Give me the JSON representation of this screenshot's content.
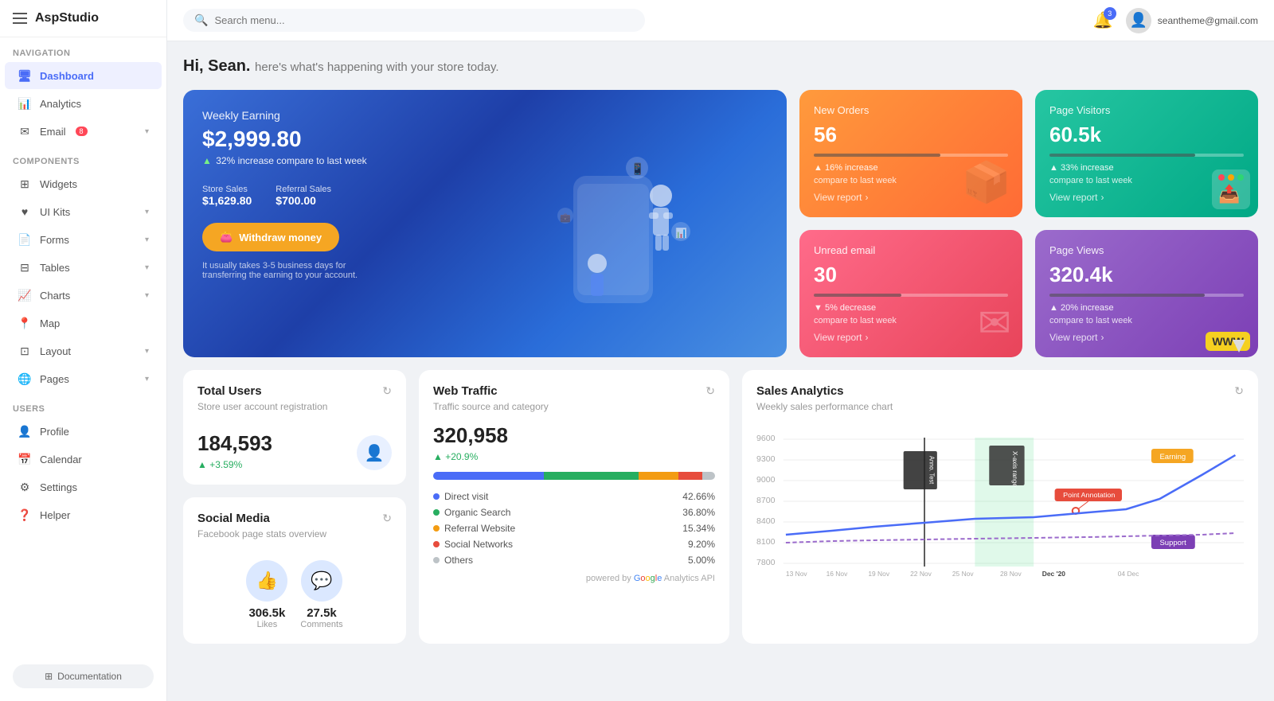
{
  "app": {
    "logo": "AspStudio",
    "search_placeholder": "Search menu..."
  },
  "topbar": {
    "notif_count": "3",
    "user_email": "seantheme@gmail.com"
  },
  "sidebar": {
    "sections": [
      {
        "label": "Navigation",
        "items": [
          {
            "id": "dashboard",
            "label": "Dashboard",
            "icon": "🖥",
            "active": true
          },
          {
            "id": "analytics",
            "label": "Analytics",
            "icon": "📊",
            "active": false
          },
          {
            "id": "email",
            "label": "Email",
            "icon": "✉",
            "active": false,
            "badge": "8",
            "arrow": true
          }
        ]
      },
      {
        "label": "Components",
        "items": [
          {
            "id": "widgets",
            "label": "Widgets",
            "icon": "⊞",
            "active": false
          },
          {
            "id": "ui-kits",
            "label": "UI Kits",
            "icon": "♥",
            "active": false,
            "arrow": true
          },
          {
            "id": "forms",
            "label": "Forms",
            "icon": "📄",
            "active": false,
            "arrow": true
          },
          {
            "id": "tables",
            "label": "Tables",
            "icon": "⊟",
            "active": false,
            "arrow": true
          },
          {
            "id": "charts",
            "label": "Charts",
            "icon": "📈",
            "active": false,
            "arrow": true
          },
          {
            "id": "map",
            "label": "Map",
            "icon": "📍",
            "active": false
          },
          {
            "id": "layout",
            "label": "Layout",
            "icon": "⊡",
            "active": false,
            "arrow": true
          },
          {
            "id": "pages",
            "label": "Pages",
            "icon": "🌐",
            "active": false,
            "arrow": true
          }
        ]
      },
      {
        "label": "Users",
        "items": [
          {
            "id": "profile",
            "label": "Profile",
            "icon": "👤",
            "active": false
          },
          {
            "id": "calendar",
            "label": "Calendar",
            "icon": "📅",
            "active": false
          },
          {
            "id": "settings",
            "label": "Settings",
            "icon": "⚙",
            "active": false
          },
          {
            "id": "helper",
            "label": "Helper",
            "icon": "❓",
            "active": false
          }
        ]
      }
    ],
    "doc_button": "Documentation"
  },
  "greeting": {
    "name": "Hi, Sean.",
    "subtitle": "here's what's happening with your store today."
  },
  "earning_card": {
    "title": "Weekly Earning",
    "amount": "$2,999.80",
    "change": "32% increase compare to last week",
    "store_label": "Store Sales",
    "store_value": "$1,629.80",
    "referral_label": "Referral Sales",
    "referral_value": "$700.00",
    "button": "Withdraw money",
    "note": "It usually takes 3-5 business days for transferring the earning to your account."
  },
  "stat_cards": [
    {
      "id": "new-orders",
      "title": "New Orders",
      "value": "56",
      "progress": 65,
      "change_direction": "up",
      "change": "16% increase",
      "change_sub": "compare to last week",
      "link": "View report",
      "color": "orange"
    },
    {
      "id": "unread-email",
      "title": "Unread email",
      "value": "30",
      "progress": 45,
      "change_direction": "down",
      "change": "5% decrease",
      "change_sub": "compare to last week",
      "link": "View report",
      "color": "red"
    },
    {
      "id": "page-visitors",
      "title": "Page Visitors",
      "value": "60.5k",
      "progress": 75,
      "change_direction": "up",
      "change": "33% increase",
      "change_sub": "compare to last week",
      "link": "View report",
      "color": "teal"
    },
    {
      "id": "page-views",
      "title": "Page Views",
      "value": "320.4k",
      "progress": 80,
      "change_direction": "up",
      "change": "20% increase",
      "change_sub": "compare to last week",
      "link": "View report",
      "color": "purple"
    }
  ],
  "total_users": {
    "title": "Total Users",
    "subtitle": "Store user account registration",
    "value": "184,593",
    "change": "+3.59%",
    "refresh": "↻"
  },
  "social_media": {
    "title": "Social Media",
    "subtitle": "Facebook page stats overview",
    "likes_value": "306.5k",
    "likes_label": "Likes",
    "comments_value": "27.5k",
    "comments_label": "Comments",
    "refresh": "↻"
  },
  "web_traffic": {
    "title": "Web Traffic",
    "subtitle": "Traffic source and category",
    "value": "320,958",
    "change": "+20.9%",
    "refresh": "↻",
    "sources": [
      {
        "label": "Direct visit",
        "pct": 42.66,
        "color": "#4a6cf7"
      },
      {
        "label": "Organic Search",
        "pct": 36.8,
        "color": "#27ae60"
      },
      {
        "label": "Referral Website",
        "pct": 15.34,
        "color": "#f39c12"
      },
      {
        "label": "Social Networks",
        "pct": 9.2,
        "color": "#e74c3c"
      },
      {
        "label": "Others",
        "pct": 5.0,
        "color": "#bdc3c7"
      }
    ],
    "powered": "powered by Google Analytics API"
  },
  "sales_analytics": {
    "title": "Sales Analytics",
    "subtitle": "Weekly sales performance chart",
    "refresh": "↻",
    "y_labels": [
      "9600",
      "9300",
      "9000",
      "8700",
      "8400",
      "8100",
      "7800"
    ],
    "x_labels": [
      "13 Nov",
      "16 Nov",
      "19 Nov",
      "22 Nov",
      "25 Nov",
      "28 Nov",
      "Dec '20",
      "04 Dec"
    ],
    "earning_label": "Earning",
    "support_label": "Support",
    "annotation_label": "Anno. Test",
    "xrange_label": "X-axis range",
    "point_label": "Point Annotation"
  }
}
